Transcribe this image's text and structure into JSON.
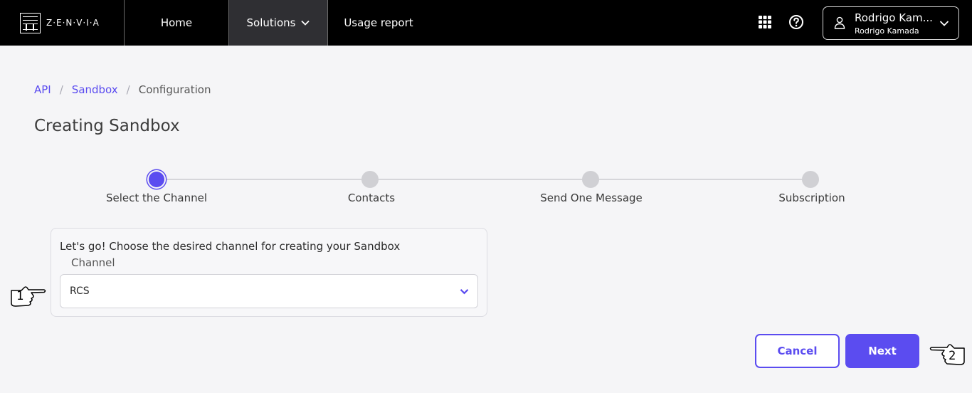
{
  "header": {
    "logo_text": "Z·E·N·V·I·A",
    "nav": [
      {
        "label": "Home"
      },
      {
        "label": "Solutions"
      },
      {
        "label": "Usage report"
      }
    ],
    "user": {
      "name": "Rodrigo Kam...",
      "subtitle": "Rodrigo Kamada"
    }
  },
  "breadcrumb": {
    "items": [
      {
        "label": "API"
      },
      {
        "label": "Sandbox"
      },
      {
        "label": "Configuration"
      }
    ]
  },
  "page": {
    "title": "Creating Sandbox"
  },
  "stepper": {
    "steps": [
      {
        "label": "Select the Channel"
      },
      {
        "label": "Contacts"
      },
      {
        "label": "Send One Message"
      },
      {
        "label": "Subscription"
      }
    ],
    "active_index": 0
  },
  "form": {
    "intro": "Let's go! Choose the desired channel for creating your Sandbox",
    "channel_label": "Channel",
    "channel_value": "RCS"
  },
  "actions": {
    "cancel_label": "Cancel",
    "next_label": "Next"
  },
  "annotations": {
    "hand_1": "1",
    "hand_2": "2"
  },
  "colors": {
    "accent": "#5b4cf0",
    "topbar": "#000000"
  }
}
